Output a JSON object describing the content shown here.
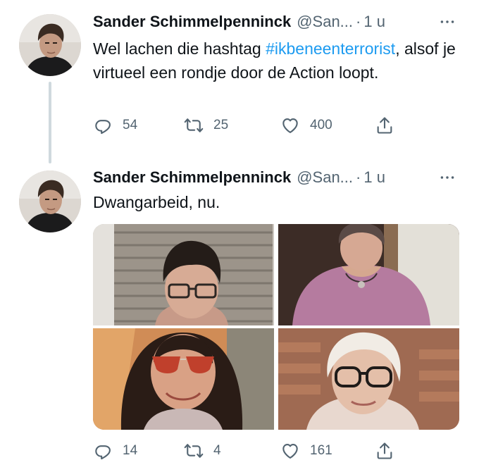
{
  "tweets": [
    {
      "author_name": "Sander Schimmelpenninck",
      "handle": "@San...",
      "separator": "·",
      "time": "1 u",
      "text_before": "Wel lachen die hashtag ",
      "hashtag": "#ikbeneenterrorist",
      "text_after": ", alsof je virtueel een rondje door de Action loopt.",
      "replies": "54",
      "retweets": "25",
      "likes": "400"
    },
    {
      "author_name": "Sander Schimmelpenninck",
      "handle": "@San...",
      "separator": "·",
      "time": "1 u",
      "text": "Dwangarbeid, nu.",
      "replies": "14",
      "retweets": "4",
      "likes": "161"
    }
  ],
  "icons": {
    "more": "more-horizontal-icon",
    "reply": "reply-icon",
    "retweet": "retweet-icon",
    "like": "heart-icon",
    "share": "share-icon"
  },
  "colors": {
    "hashtag": "#1d9bf0",
    "secondary_text": "#536471",
    "thread_line": "#cfd9de"
  }
}
